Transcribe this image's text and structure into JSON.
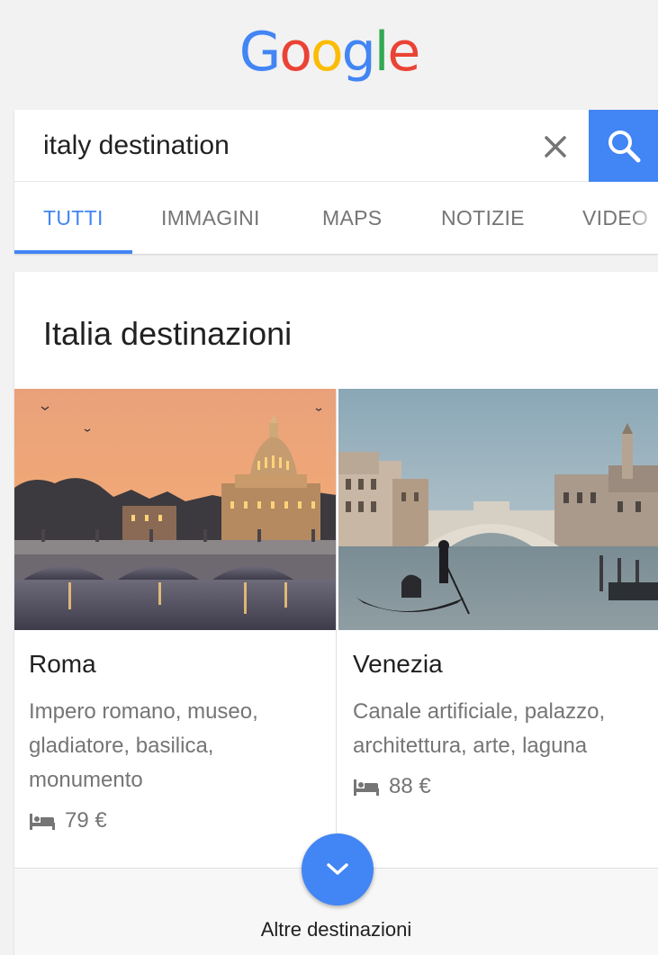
{
  "logo": {
    "letters": [
      "G",
      "o",
      "o",
      "g",
      "l",
      "e"
    ],
    "colors": [
      "#4285f4",
      "#ea4335",
      "#fbbc05",
      "#4285f4",
      "#34a853",
      "#ea4335"
    ]
  },
  "search": {
    "query": "italy destination",
    "clear_icon": "close-icon",
    "search_icon": "search-icon",
    "accent": "#4285f4"
  },
  "tabs": [
    {
      "label": "TUTTI",
      "active": true
    },
    {
      "label": "IMMAGINI",
      "active": false
    },
    {
      "label": "MAPS",
      "active": false
    },
    {
      "label": "NOTIZIE",
      "active": false
    },
    {
      "label": "VIDEO",
      "active": false
    }
  ],
  "card": {
    "title": "Italia destinazioni",
    "destinations": [
      {
        "name": "Roma",
        "description": "Impero romano, museo, gladiatore, basilica, monumento",
        "price": "79 €",
        "price_icon": "bed-icon"
      },
      {
        "name": "Venezia",
        "description": "Canale artificiale, palazzo, architettura, arte, laguna",
        "price": "88 €",
        "price_icon": "bed-icon"
      }
    ],
    "more_label": "Altre destinazioni",
    "more_icon": "chevron-down-icon"
  }
}
